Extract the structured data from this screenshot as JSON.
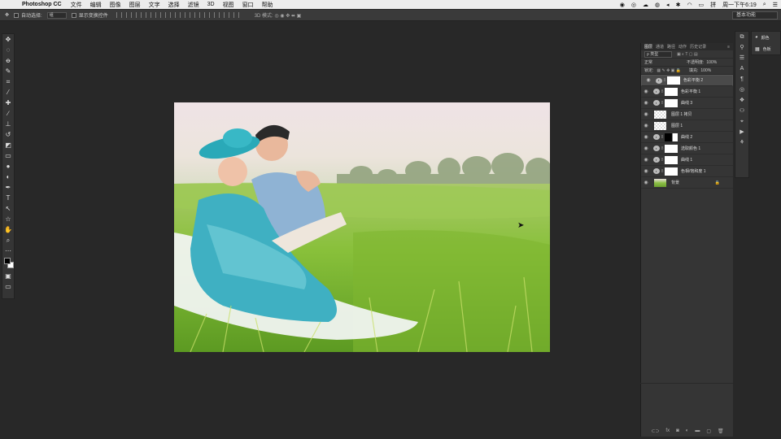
{
  "menubar": {
    "app_name": "Photoshop CC",
    "items": [
      "文件",
      "编辑",
      "图像",
      "图层",
      "文字",
      "选择",
      "滤镜",
      "3D",
      "视图",
      "窗口",
      "帮助"
    ],
    "clock": "周一下午6:19"
  },
  "options_bar": {
    "auto_select_label": "自动选择:",
    "auto_select_value": "组",
    "show_transform_label": "显示变换控件"
  },
  "workspace": {
    "label": "基本功能"
  },
  "panels": {
    "tabs": [
      "图层",
      "通道",
      "路径",
      "动作",
      "历史记录"
    ],
    "filter_label": "ρ 类型",
    "blend_mode": "正常",
    "opacity_label": "不透明度:",
    "opacity_value": "100%",
    "lock_label": "锁定:",
    "fill_label": "填充:",
    "fill_value": "100%",
    "layers": [
      {
        "name": "色彩平衡 2",
        "kind": "adjustment",
        "mask": "white",
        "selected": true
      },
      {
        "name": "色彩平衡 1",
        "kind": "adjustment",
        "mask": "white",
        "selected": false
      },
      {
        "name": "曲线 3",
        "kind": "adjustment",
        "mask": "white",
        "selected": false
      },
      {
        "name": "图层 1 拷贝",
        "kind": "pixel",
        "selected": false
      },
      {
        "name": "图层 1",
        "kind": "pixel",
        "selected": false
      },
      {
        "name": "曲线 2",
        "kind": "adjustment",
        "mask": "dark",
        "selected": false
      },
      {
        "name": "选取颜色 1",
        "kind": "adjustment",
        "mask": "white",
        "selected": false
      },
      {
        "name": "曲线 1",
        "kind": "adjustment",
        "mask": "white",
        "selected": false
      },
      {
        "name": "色相/饱和度 1",
        "kind": "adjustment",
        "mask": "white",
        "selected": false
      },
      {
        "name": "背景",
        "kind": "background",
        "selected": false
      }
    ]
  },
  "side_panel": {
    "items": [
      {
        "label": "颜色",
        "icon": "color-icon"
      },
      {
        "label": "色板",
        "icon": "swatches-icon"
      }
    ]
  },
  "colors": {
    "fg": "#000000",
    "bg": "#ffffff",
    "ui_bg": "#282828",
    "panel": "#353535"
  }
}
